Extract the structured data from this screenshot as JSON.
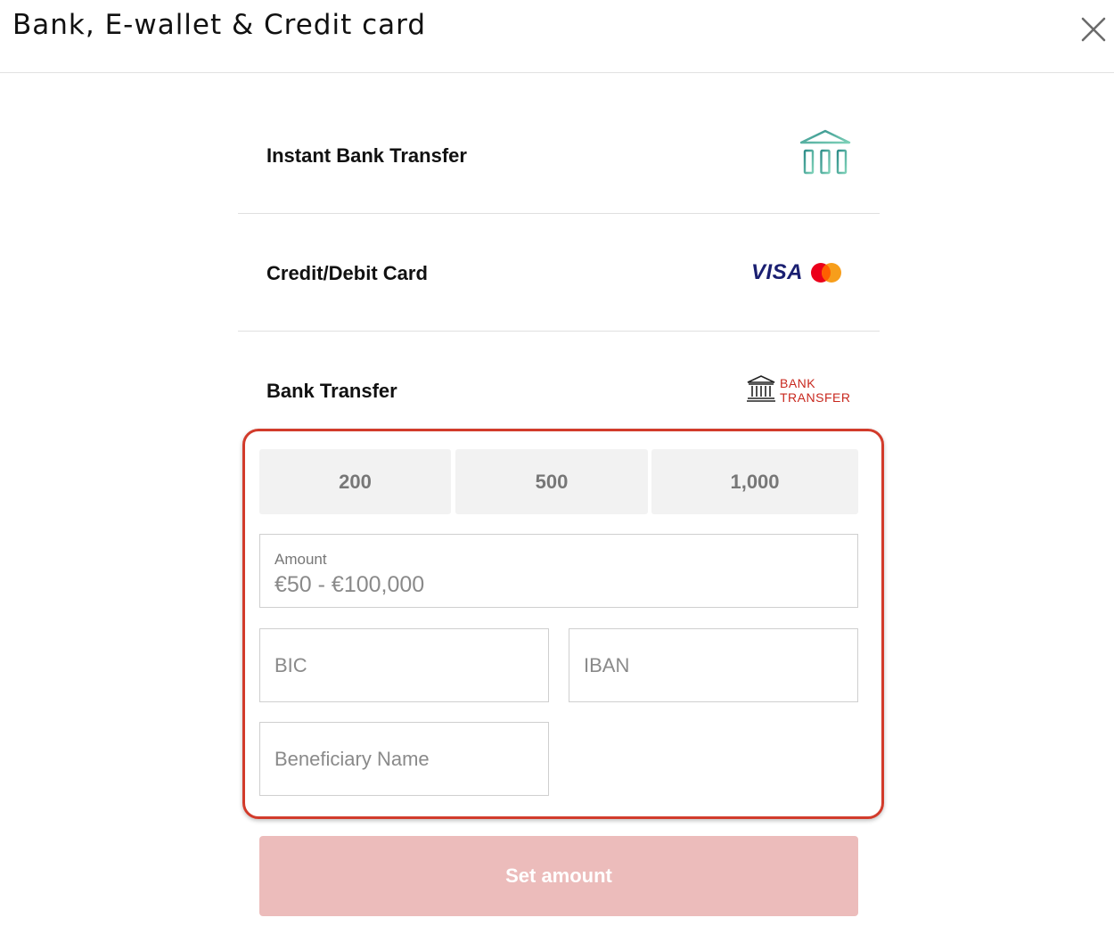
{
  "header": {
    "title": "Bank, E-wallet & Credit card",
    "close_icon": "close-icon"
  },
  "methods": [
    {
      "label": "Instant Bank Transfer",
      "icon": "bank-building-icon",
      "icon_color": "#3fa89a"
    },
    {
      "label": "Credit/Debit Card",
      "icon": "visa-mastercard-logo",
      "visa_text": "VISA",
      "visa_color": "#1a1f71"
    },
    {
      "label": "Bank Transfer",
      "icon": "bank-transfer-logo",
      "logo_text_1": "BANK",
      "logo_text_2": "TRANSFER",
      "logo_color": "#c8281e"
    }
  ],
  "form": {
    "presets": [
      "200",
      "500",
      "1,000"
    ],
    "amount": {
      "label": "Amount",
      "placeholder": "€50 - €100,000"
    },
    "bic": {
      "placeholder": "BIC"
    },
    "iban": {
      "placeholder": "IBAN"
    },
    "beneficiary": {
      "placeholder": "Beneficiary Name"
    },
    "highlight_color": "#d23b2b"
  },
  "submit": {
    "label": "Set amount",
    "color": "#ecbcbb"
  }
}
